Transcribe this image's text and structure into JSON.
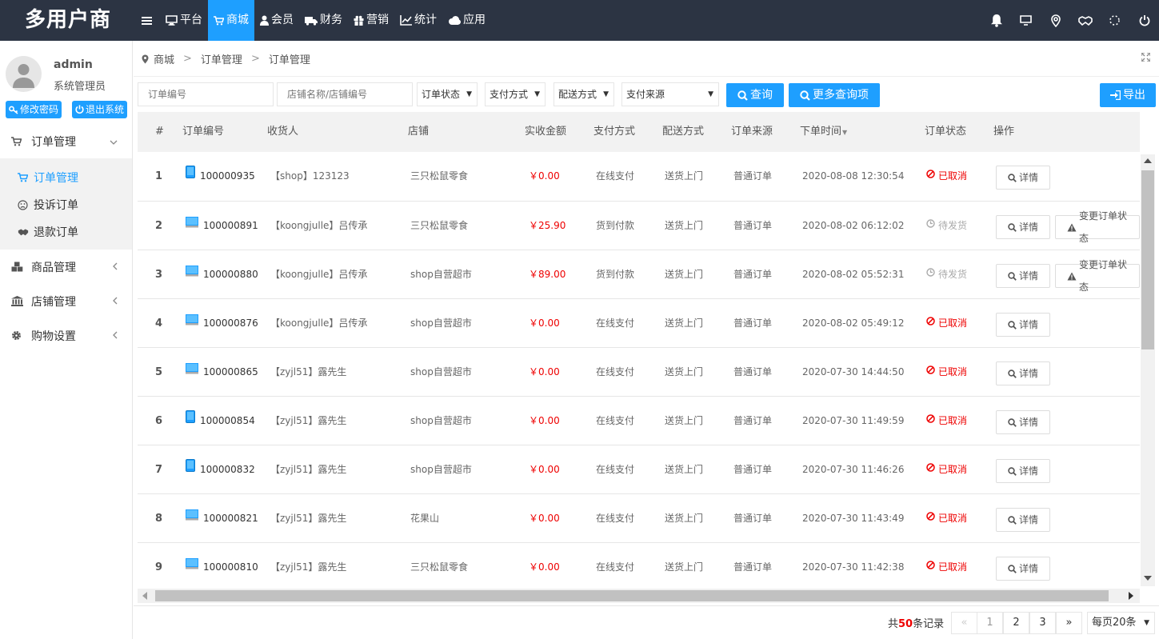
{
  "brand": "多用户商",
  "nav": [
    "平台",
    "商城",
    "会员",
    "财务",
    "营销",
    "统计",
    "应用"
  ],
  "nav_active": 1,
  "top_icons": [
    "bell-icon",
    "monitor-icon",
    "location-pin-icon",
    "handshake-icon",
    "spinner-icon",
    "power-icon"
  ],
  "user": {
    "name": "admin",
    "role": "系统管理员",
    "change_pwd": "修改密码",
    "logout": "退出系统"
  },
  "menu": {
    "order_mgmt": "订单管理",
    "sub": [
      "订单管理",
      "投诉订单",
      "退款订单"
    ],
    "goods_mgmt": "商品管理",
    "shop_mgmt": "店铺管理",
    "shopping_settings": "购物设置"
  },
  "breadcrumb": [
    "商城",
    "订单管理",
    "订单管理"
  ],
  "filters": {
    "order_no_placeholder": "订单编号",
    "shop_placeholder": "店铺名称/店铺编号",
    "status": "订单状态",
    "payment": "支付方式",
    "delivery": "配送方式",
    "source": "支付来源",
    "query": "查询",
    "more_query": "更多查询项",
    "export": "导出"
  },
  "columns": [
    "#",
    "订单编号",
    "收货人",
    "店铺",
    "实收金额",
    "支付方式",
    "配送方式",
    "订单来源",
    "下单时间",
    "订单状态",
    "操作"
  ],
  "rows": [
    {
      "n": "1",
      "device": "mobile",
      "id": "100000935",
      "receiver": "【shop】123123",
      "shop": "三只松鼠零食",
      "amount": "￥0.00",
      "pay": "在线支付",
      "delivery": "送货上门",
      "source": "普通订单",
      "time": "2020-08-08 12:30:54",
      "status": "已取消",
      "status_type": "cancel",
      "actions": [
        "详情"
      ]
    },
    {
      "n": "2",
      "device": "pc",
      "id": "100000891",
      "receiver": "【koongjulle】吕传承",
      "shop": "三只松鼠零食",
      "amount": "￥25.90",
      "pay": "货到付款",
      "delivery": "送货上门",
      "source": "普通订单",
      "time": "2020-08-02 06:12:02",
      "status": "待发货",
      "status_type": "wait",
      "actions": [
        "详情",
        "变更订单状态"
      ]
    },
    {
      "n": "3",
      "device": "pc",
      "id": "100000880",
      "receiver": "【koongjulle】吕传承",
      "shop": "shop自营超市",
      "amount": "￥89.00",
      "pay": "货到付款",
      "delivery": "送货上门",
      "source": "普通订单",
      "time": "2020-08-02 05:52:31",
      "status": "待发货",
      "status_type": "wait",
      "actions": [
        "详情",
        "变更订单状态"
      ]
    },
    {
      "n": "4",
      "device": "pc",
      "id": "100000876",
      "receiver": "【koongjulle】吕传承",
      "shop": "shop自营超市",
      "amount": "￥0.00",
      "pay": "在线支付",
      "delivery": "送货上门",
      "source": "普通订单",
      "time": "2020-08-02 05:49:12",
      "status": "已取消",
      "status_type": "cancel",
      "actions": [
        "详情"
      ]
    },
    {
      "n": "5",
      "device": "pc",
      "id": "100000865",
      "receiver": "【zyjl51】露先生",
      "shop": "shop自营超市",
      "amount": "￥0.00",
      "pay": "在线支付",
      "delivery": "送货上门",
      "source": "普通订单",
      "time": "2020-07-30 14:44:50",
      "status": "已取消",
      "status_type": "cancel",
      "actions": [
        "详情"
      ]
    },
    {
      "n": "6",
      "device": "mobile",
      "id": "100000854",
      "receiver": "【zyjl51】露先生",
      "shop": "shop自营超市",
      "amount": "￥0.00",
      "pay": "在线支付",
      "delivery": "送货上门",
      "source": "普通订单",
      "time": "2020-07-30 11:49:59",
      "status": "已取消",
      "status_type": "cancel",
      "actions": [
        "详情"
      ]
    },
    {
      "n": "7",
      "device": "mobile",
      "id": "100000832",
      "receiver": "【zyjl51】露先生",
      "shop": "shop自营超市",
      "amount": "￥0.00",
      "pay": "在线支付",
      "delivery": "送货上门",
      "source": "普通订单",
      "time": "2020-07-30 11:46:26",
      "status": "已取消",
      "status_type": "cancel",
      "actions": [
        "详情"
      ]
    },
    {
      "n": "8",
      "device": "pc",
      "id": "100000821",
      "receiver": "【zyjl51】露先生",
      "shop": "花果山",
      "amount": "￥0.00",
      "pay": "在线支付",
      "delivery": "送货上门",
      "source": "普通订单",
      "time": "2020-07-30 11:43:49",
      "status": "已取消",
      "status_type": "cancel",
      "actions": [
        "详情"
      ]
    },
    {
      "n": "9",
      "device": "pc",
      "id": "100000810",
      "receiver": "【zyjl51】露先生",
      "shop": "三只松鼠零食",
      "amount": "￥0.00",
      "pay": "在线支付",
      "delivery": "送货上门",
      "source": "普通订单",
      "time": "2020-07-30 11:42:38",
      "status": "已取消",
      "status_type": "cancel",
      "actions": [
        "详情"
      ]
    }
  ],
  "pagination": {
    "total_prefix": "共",
    "total": "50",
    "total_suffix": "条记录",
    "prev": "«",
    "pages": [
      "1",
      "2",
      "3"
    ],
    "next": "»",
    "per_page": "每页20条"
  },
  "colors": {
    "topbar": "#2c3443",
    "accent": "#1e9fff",
    "red": "#e00"
  }
}
